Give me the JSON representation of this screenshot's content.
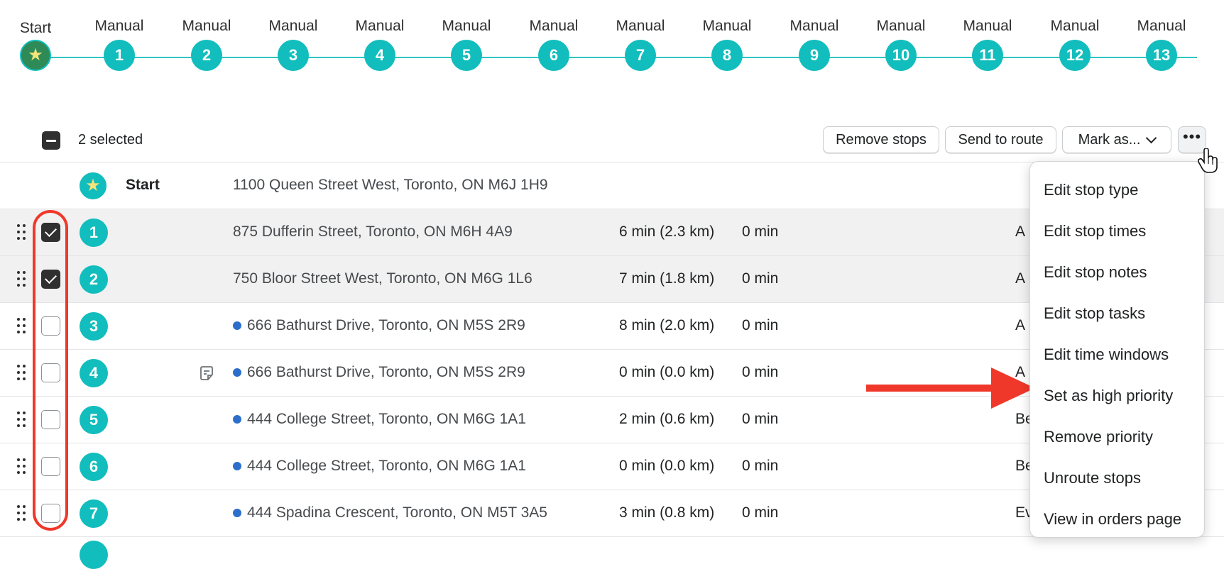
{
  "timeline": {
    "start_label": "Start",
    "stops": [
      {
        "label": "Manual",
        "number": "1"
      },
      {
        "label": "Manual",
        "number": "2"
      },
      {
        "label": "Manual",
        "number": "3"
      },
      {
        "label": "Manual",
        "number": "4"
      },
      {
        "label": "Manual",
        "number": "5"
      },
      {
        "label": "Manual",
        "number": "6"
      },
      {
        "label": "Manual",
        "number": "7"
      },
      {
        "label": "Manual",
        "number": "8"
      },
      {
        "label": "Manual",
        "number": "9"
      },
      {
        "label": "Manual",
        "number": "10"
      },
      {
        "label": "Manual",
        "number": "11"
      },
      {
        "label": "Manual",
        "number": "12"
      },
      {
        "label": "Manual",
        "number": "13"
      }
    ]
  },
  "toolbar": {
    "selected_text": "2 selected",
    "remove_label": "Remove stops",
    "send_label": "Send to route",
    "mark_label": "Mark as...",
    "more_label": "•••"
  },
  "start_row": {
    "name": "Start",
    "address": "1100 Queen Street West, Toronto, ON M6J 1H9"
  },
  "rows": [
    {
      "number": "1",
      "address": "875 Dufferin Street, Toronto, ON M6H 4A9",
      "drive": "6 min (2.3 km)",
      "wait": "0 min",
      "trail": "A",
      "checked": true,
      "dot": false,
      "note": false
    },
    {
      "number": "2",
      "address": "750 Bloor Street West, Toronto, ON M6G 1L6",
      "drive": "7 min (1.8 km)",
      "wait": "0 min",
      "trail": "A",
      "checked": true,
      "dot": false,
      "note": false
    },
    {
      "number": "3",
      "address": "666 Bathurst Drive, Toronto, ON M5S 2R9",
      "drive": "8 min (2.0 km)",
      "wait": "0 min",
      "trail": "A",
      "checked": false,
      "dot": true,
      "note": false
    },
    {
      "number": "4",
      "address": "666 Bathurst Drive, Toronto, ON M5S 2R9",
      "drive": "0 min (0.0 km)",
      "wait": "0 min",
      "trail": "A",
      "checked": false,
      "dot": true,
      "note": true
    },
    {
      "number": "5",
      "address": "444 College Street, Toronto, ON M6G 1A1",
      "drive": "2 min (0.6 km)",
      "wait": "0 min",
      "trail": "Be",
      "checked": false,
      "dot": true,
      "note": false
    },
    {
      "number": "6",
      "address": "444 College Street, Toronto, ON M6G 1A1",
      "drive": "0 min (0.0 km)",
      "wait": "0 min",
      "trail": "Be",
      "checked": false,
      "dot": true,
      "note": false
    },
    {
      "number": "7",
      "address": "444 Spadina Crescent, Toronto, ON M5T 3A5",
      "drive": "3 min (0.8 km)",
      "wait": "0 min",
      "trail": "Ev",
      "checked": false,
      "dot": true,
      "note": false
    }
  ],
  "menu": {
    "items": [
      "Edit stop type",
      "Edit stop times",
      "Edit stop notes",
      "Edit stop tasks",
      "Edit time windows",
      "Set as high priority",
      "Remove priority",
      "Unroute stops",
      "View in orders page"
    ]
  },
  "icons": {
    "start": "star-icon",
    "drag": "drag-handle-icon",
    "note": "note-icon",
    "more": "more-horizontal-icon",
    "chevron": "chevron-down-icon",
    "cursor": "hand-pointer-icon"
  },
  "colors": {
    "teal": "#12bdbd",
    "start_green": "#2e8b57",
    "star_yellow": "#f6e37a",
    "annotation_red": "#f0382a",
    "priority_dot_blue": "#2c6ecb"
  }
}
